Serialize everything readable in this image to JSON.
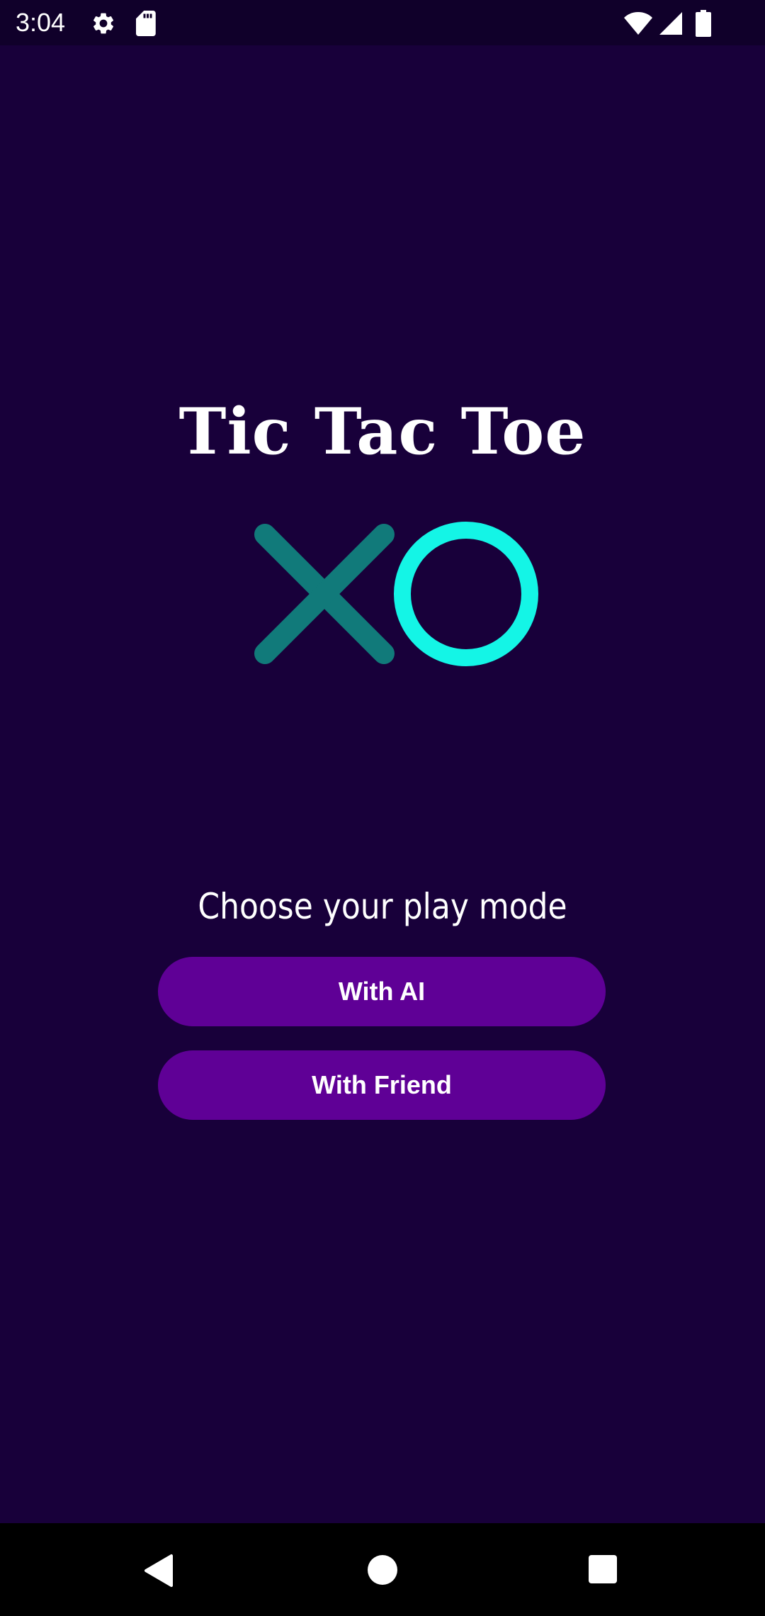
{
  "status_bar": {
    "time": "3:04",
    "icons": [
      "gear-icon",
      "sd-card-icon",
      "wifi-icon",
      "cell-signal-icon",
      "battery-icon"
    ]
  },
  "app": {
    "title": "Tic Tac Toe",
    "logo_icons": [
      "x-mark-icon",
      "o-mark-icon"
    ],
    "subtitle": "Choose your play mode"
  },
  "buttons": {
    "with_ai": "With AI",
    "with_friend": "With Friend"
  },
  "nav_bar": {
    "icons": [
      "back-icon",
      "home-icon",
      "recents-icon"
    ]
  },
  "colors": {
    "background": "#18003a",
    "status_bar": "#10002a",
    "button": "#5f0096",
    "x_mark": "#117a7a",
    "o_mark": "#14f5e6",
    "text": "#ffffff",
    "nav_bar": "#000000"
  }
}
